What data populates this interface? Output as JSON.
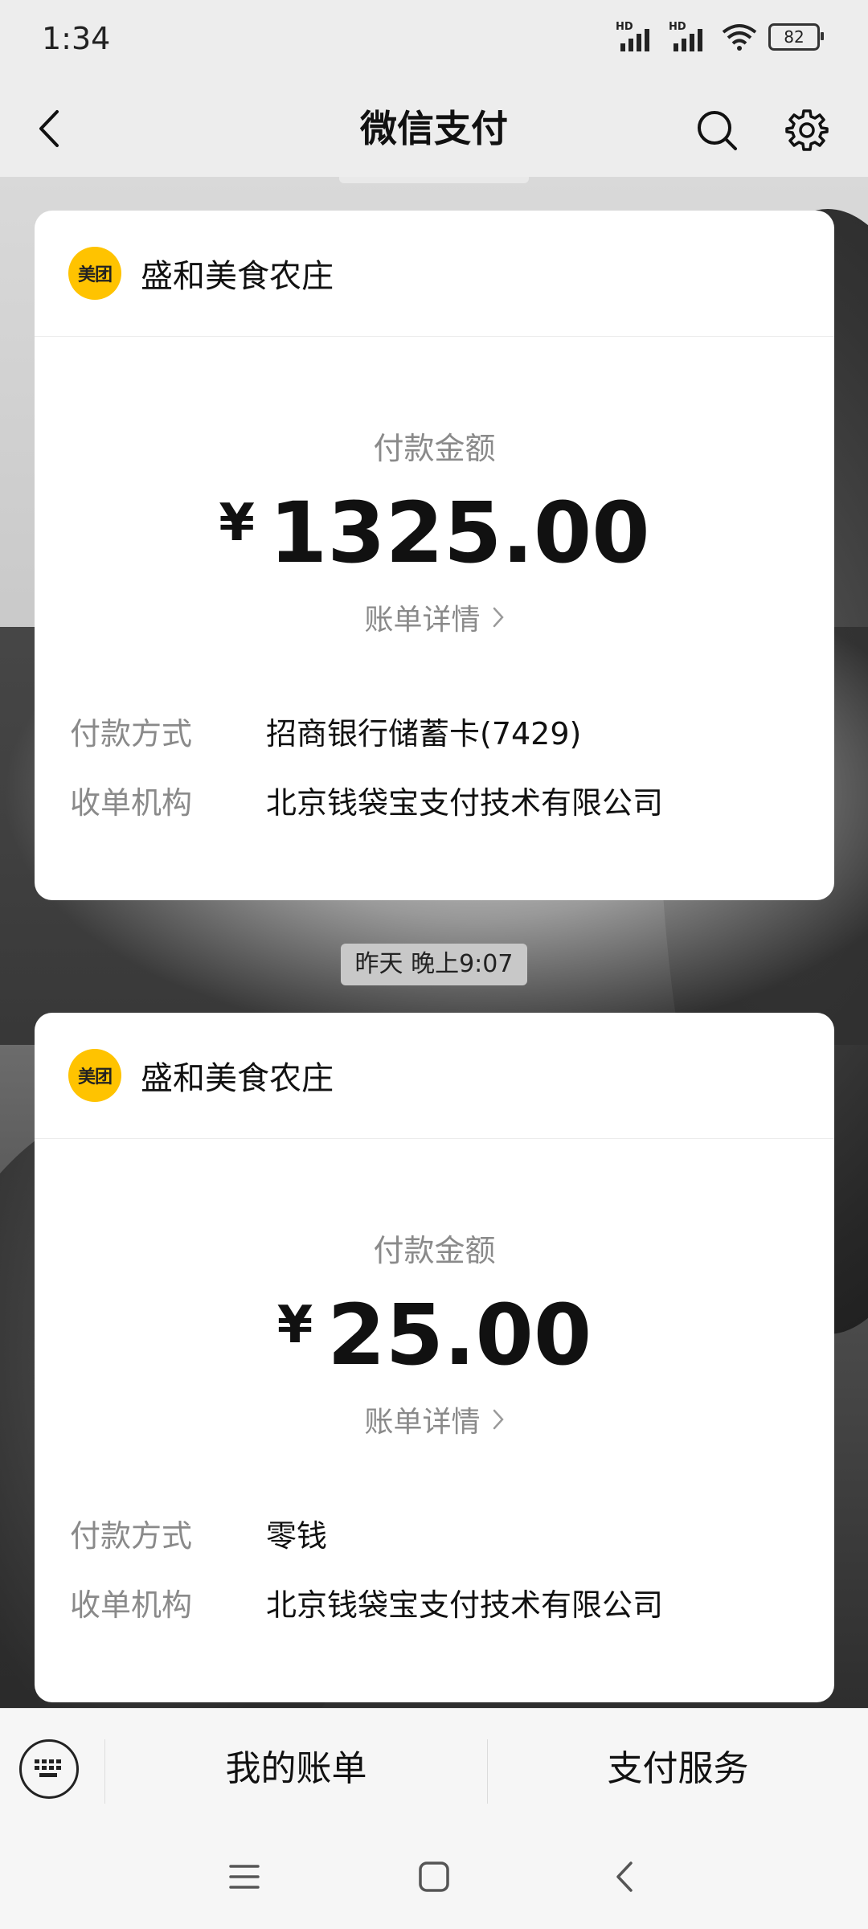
{
  "status_bar": {
    "time": "1:34",
    "signal1_label": "HD",
    "signal2_label": "HD",
    "battery": "82"
  },
  "nav": {
    "title": "微信支付",
    "back_icon": "chevron-left-icon",
    "search_icon": "search-icon",
    "settings_icon": "gear-icon"
  },
  "transactions": [
    {
      "merchant_logo": "美团",
      "merchant_name": "盛和美食农庄",
      "amount_label": "付款金额",
      "currency": "¥",
      "amount": "1325.00",
      "bill_detail": "账单详情",
      "payment_method_label": "付款方式",
      "payment_method": "招商银行储蓄卡(7429)",
      "acquirer_label": "收单机构",
      "acquirer": "北京钱袋宝支付技术有限公司"
    },
    {
      "merchant_logo": "美团",
      "merchant_name": "盛和美食农庄",
      "amount_label": "付款金额",
      "currency": "¥",
      "amount": "25.00",
      "bill_detail": "账单详情",
      "payment_method_label": "付款方式",
      "payment_method": "零钱",
      "acquirer_label": "收单机构",
      "acquirer": "北京钱袋宝支付技术有限公司"
    }
  ],
  "timestamp": "昨天 晚上9:07",
  "bottom_bar": {
    "keyboard_icon": "keyboard-icon",
    "my_bills": "我的账单",
    "pay_services": "支付服务"
  },
  "colors": {
    "meituan_yellow": "#ffc300",
    "background": "#ededed",
    "card": "#ffffff",
    "muted_text": "#8a8a8a"
  }
}
